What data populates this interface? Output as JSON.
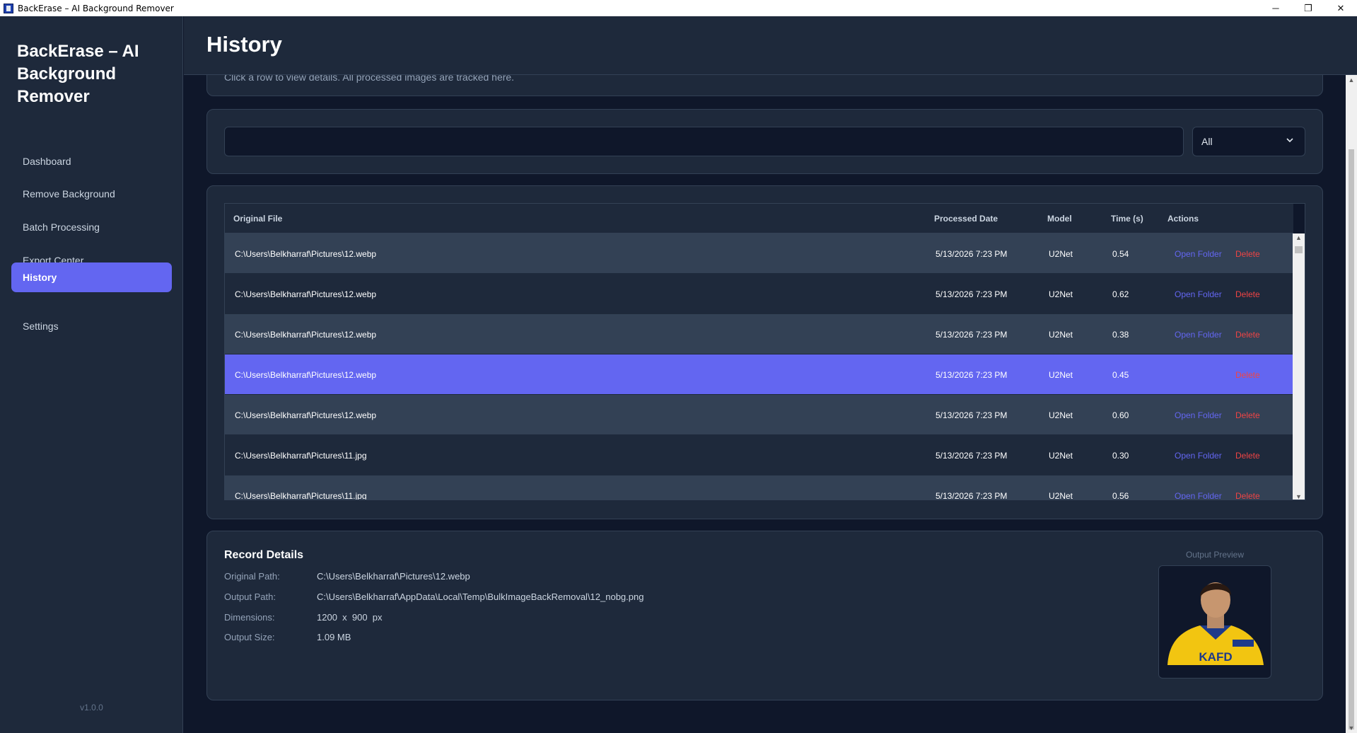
{
  "window": {
    "title": "BackErase – AI Background Remover",
    "minimize": "─",
    "maximize": "❐",
    "close": "✕"
  },
  "sidebar": {
    "brand": "BackErase – AI Background Remover",
    "items": [
      {
        "label": "Dashboard"
      },
      {
        "label": "Remove Background"
      },
      {
        "label": "Batch Processing"
      },
      {
        "label": "Export Center"
      },
      {
        "label": "History",
        "active": true
      },
      {
        "label": "Settings"
      }
    ],
    "version": "v1.0.0"
  },
  "header": {
    "title": "History"
  },
  "info": {
    "text": "Click a row to view details. All processed images are tracked here."
  },
  "filter": {
    "search_value": "",
    "select_value": "All"
  },
  "table": {
    "columns": [
      "Original File",
      "Processed Date",
      "Model",
      "Time (s)",
      "Actions"
    ],
    "open_label": "Open Folder",
    "delete_label": "Delete",
    "rows": [
      {
        "file": "C:\\Users\\Belkharraf\\Pictures\\12.webp",
        "date": "5/13/2026 7:23 PM",
        "model": "U2Net",
        "time": "0.54",
        "open": "Open Folder",
        "delete": "Delete"
      },
      {
        "file": "C:\\Users\\Belkharraf\\Pictures\\12.webp",
        "date": "5/13/2026 7:23 PM",
        "model": "U2Net",
        "time": "0.62",
        "open": "Open Folder",
        "delete": "Delete"
      },
      {
        "file": "C:\\Users\\Belkharraf\\Pictures\\12.webp",
        "date": "5/13/2026 7:23 PM",
        "model": "U2Net",
        "time": "0.38",
        "open": "Open Folder",
        "delete": "Delete"
      },
      {
        "file": "C:\\Users\\Belkharraf\\Pictures\\12.webp",
        "date": "5/13/2026 7:23 PM",
        "model": "U2Net",
        "time": "0.45",
        "open": "",
        "delete": "Delete",
        "selected": true
      },
      {
        "file": "C:\\Users\\Belkharraf\\Pictures\\12.webp",
        "date": "5/13/2026 7:23 PM",
        "model": "U2Net",
        "time": "0.60",
        "open": "Open Folder",
        "delete": "Delete"
      },
      {
        "file": "C:\\Users\\Belkharraf\\Pictures\\11.jpg",
        "date": "5/13/2026 7:23 PM",
        "model": "U2Net",
        "time": "0.30",
        "open": "Open Folder",
        "delete": "Delete"
      },
      {
        "file": "C:\\Users\\Belkharraf\\Pictures\\11.jpg",
        "date": "5/13/2026 7:23 PM",
        "model": "U2Net",
        "time": "0.56",
        "open": "Open Folder",
        "delete": "Delete"
      }
    ]
  },
  "details": {
    "title": "Record Details",
    "original_path_label": "Original Path:",
    "original_path": "C:\\Users\\Belkharraf\\Pictures\\12.webp",
    "output_path_label": "Output Path:",
    "output_path": "C:\\Users\\Belkharraf\\AppData\\Local\\Temp\\BulkImageBackRemoval\\12_nobg.png",
    "dimensions_label": "Dimensions:",
    "dimensions": "1200  x  900  px",
    "output_size_label": "Output Size:",
    "output_size": "1.09 MB",
    "preview_label": "Output Preview",
    "preview_badge": "KAFD"
  },
  "colors": {
    "accent": "#6366f1",
    "danger": "#ef4444",
    "bg": "#0f172a",
    "panel": "#1e293b",
    "border": "#334155"
  }
}
